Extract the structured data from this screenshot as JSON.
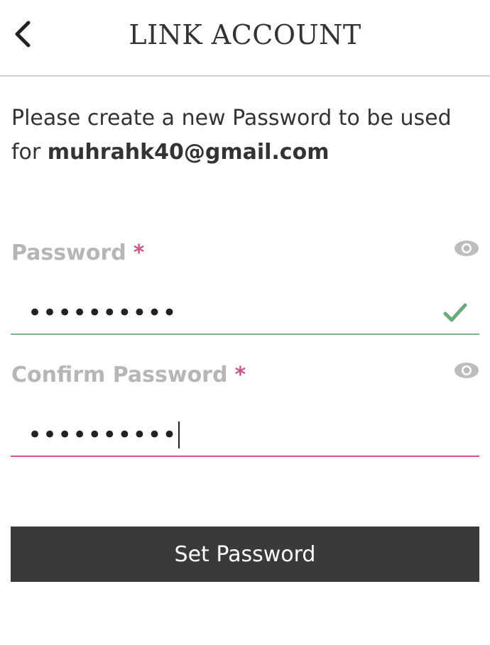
{
  "header": {
    "title": "LINK ACCOUNT",
    "back_icon": "chevron-left-icon"
  },
  "intro": {
    "text": "Please create a new Password to be used for",
    "email": "muhrahk40@gmail.com"
  },
  "password": {
    "label": "Password",
    "required_mark": "*",
    "value": "••••••••••",
    "status": "valid",
    "toggle_icon": "eye-icon",
    "status_icon": "check-icon"
  },
  "confirm_password": {
    "label": "Confirm Password",
    "required_mark": "*",
    "value": "••••••••••",
    "focused": true,
    "toggle_icon": "eye-icon"
  },
  "submit": {
    "label": "Set Password"
  },
  "colors": {
    "accent_required": "#c8588f",
    "valid_green": "#7cb58a",
    "button_bg": "#3a3a3a",
    "label_grey": "#b6b6b6"
  }
}
